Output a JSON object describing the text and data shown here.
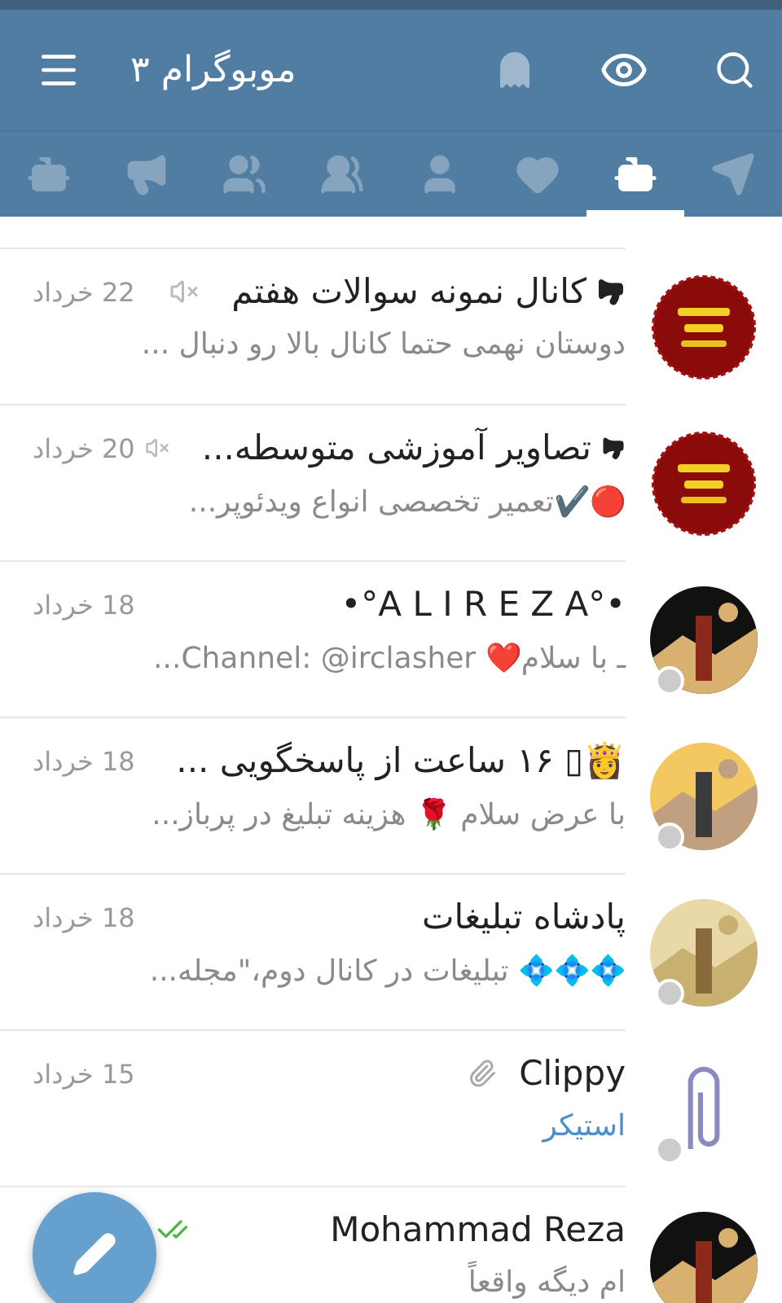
{
  "app_bar": {
    "title": "موبوگرام ۳",
    "ghost_on": false
  },
  "tabs": [
    {
      "kind": "bots",
      "selected": false
    },
    {
      "kind": "channels",
      "selected": false
    },
    {
      "kind": "supergroups",
      "selected": false
    },
    {
      "kind": "groups",
      "selected": false
    },
    {
      "kind": "contacts",
      "selected": false
    },
    {
      "kind": "favorites",
      "selected": false
    },
    {
      "kind": "mixed",
      "selected": true
    },
    {
      "kind": "all",
      "selected": false
    }
  ],
  "chats": [
    {
      "avatar": {
        "kind": "badge"
      },
      "title": "کانال نمونه سوالات هفتم",
      "channel": true,
      "muted": true,
      "attachment": false,
      "date": "22 خرداد",
      "preview": "دوستان نهمی حتما کانال بالا رو دنبال ...",
      "media": false,
      "status_dot": false,
      "read": false
    },
    {
      "avatar": {
        "kind": "badge"
      },
      "title": "تصاویر آموزشی متوسطه...",
      "channel": true,
      "muted": true,
      "attachment": false,
      "date": "20 خرداد",
      "preview": "🔴✔️تعمیر تخصصی انواع ویدئوپر...",
      "media": false,
      "status_dot": false,
      "read": false
    },
    {
      "title": "•°A L I R E Z A°•",
      "channel": false,
      "muted": false,
      "attachment": false,
      "date": "18 خرداد",
      "preview": "ـ با سلام❤️ Channel:  @irclasher...",
      "media": false,
      "status_dot": true,
      "read": false
    },
    {
      "title": "👸▯ ۱۶ ساعت از پاسخگویی ...",
      "channel": false,
      "muted": false,
      "attachment": false,
      "date": "18 خرداد",
      "preview": "با عرض سلام 🌹 هزینه تبلیغ در پرباز...",
      "media": false,
      "status_dot": true,
      "read": false
    },
    {
      "title": "پادشاه تبلیغات",
      "channel": false,
      "muted": false,
      "attachment": false,
      "date": "18 خرداد",
      "preview": "💠💠💠 تبلیغات در کانال دوم،\"مجله...",
      "media": false,
      "status_dot": true,
      "read": false
    },
    {
      "avatar": {
        "kind": "clip"
      },
      "title": "Clippy",
      "channel": false,
      "muted": false,
      "attachment": true,
      "date": "15 خرداد",
      "preview": "استیکر",
      "media": true,
      "status_dot": true,
      "read": false
    },
    {
      "title": "Mohammad Reza",
      "channel": false,
      "muted": false,
      "attachment": false,
      "preview": "ام دیگه واقعاً",
      "media": false,
      "status_dot": false,
      "read": true
    }
  ]
}
